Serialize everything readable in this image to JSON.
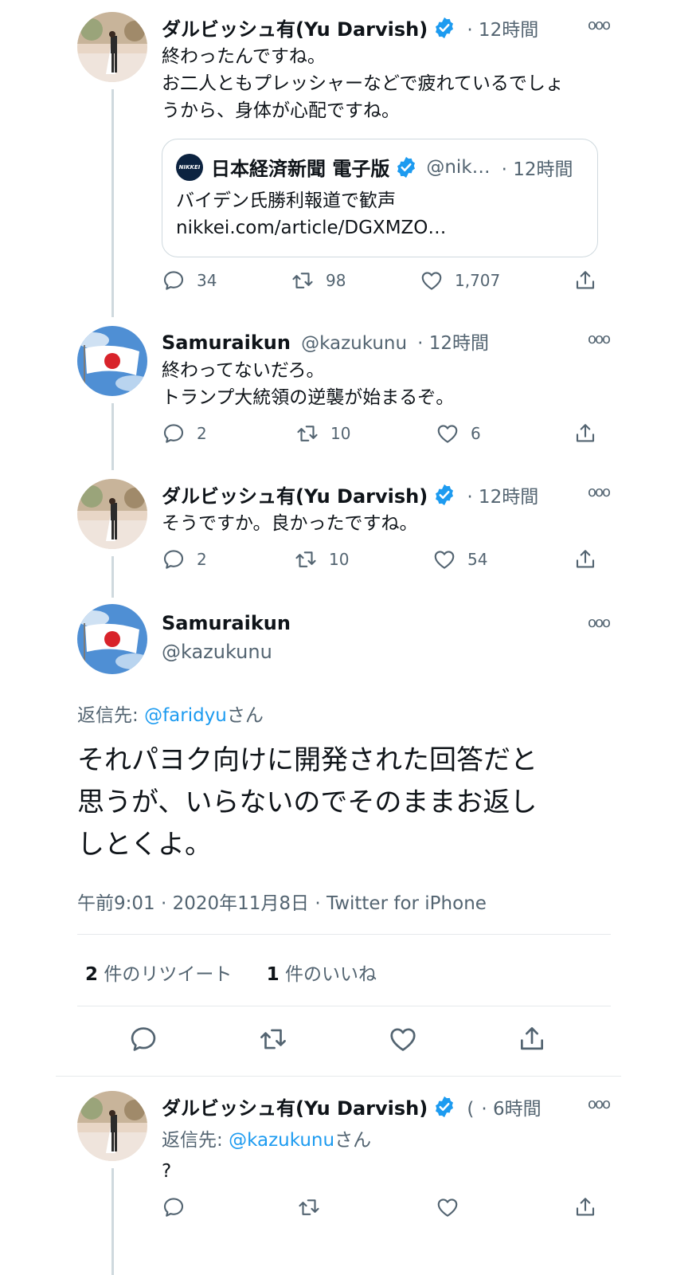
{
  "colors": {
    "accent": "#1d9bf0",
    "text": "#0f1419",
    "muted": "#536471",
    "line": "#cfd9de"
  },
  "tweet1": {
    "name": "ダルビッシュ有(Yu Darvish)",
    "time": "· 12時間",
    "lines": [
      "終わったんですね。",
      "お二人ともプレッシャーなどで疲れているでしょ",
      "うから、身体が心配ですね。"
    ],
    "quote": {
      "name": "日本経済新聞 電子版",
      "handle": "@nik…",
      "time": "· 12時間",
      "logo": "NIKKEI",
      "text": "バイデン氏勝利報道で歓声",
      "link": "nikkei.com/article/DGXMZO…"
    },
    "replies": "34",
    "retweets": "98",
    "likes": "1,707"
  },
  "tweet2": {
    "name": "Samuraikun",
    "handle": "@kazukunu",
    "time": "· 12時間",
    "lines": [
      "終わってないだろ。",
      "トランプ大統領の逆襲が始まるぞ。"
    ],
    "replies": "2",
    "retweets": "10",
    "likes": "6"
  },
  "tweet3": {
    "name": "ダルビッシュ有(Yu Darvish)",
    "time": "· 12時間",
    "lines": [
      "そうですか。良かったですね。"
    ],
    "replies": "2",
    "retweets": "10",
    "likes": "54"
  },
  "main": {
    "name": "Samuraikun",
    "handle": "@kazukunu",
    "reply_prefix": "返信先: ",
    "reply_to": "@faridyu",
    "reply_suffix": "さん",
    "lines": [
      "それパヨク向けに開発された回答だと",
      "思うが、いらないのでそのままお返し",
      "しとくよ。"
    ],
    "meta": "午前9:01 · 2020年11月8日 · Twitter for iPhone",
    "retweet_count": "2",
    "retweet_label": "件のリツイート",
    "like_count": "1",
    "like_label": "件のいいね"
  },
  "tweet4": {
    "name": "ダルビッシュ有(Yu Darvish)",
    "handle_trunc": "(",
    "time": "· 6時間",
    "reply_prefix": "返信先: ",
    "reply_to": "@kazukunu",
    "reply_suffix": "さん",
    "text": "?"
  },
  "icons": {
    "more": "more-icon",
    "reply": "reply-icon",
    "retweet": "retweet-icon",
    "like": "like-icon",
    "share": "share-icon",
    "verified": "verified-badge-icon"
  }
}
